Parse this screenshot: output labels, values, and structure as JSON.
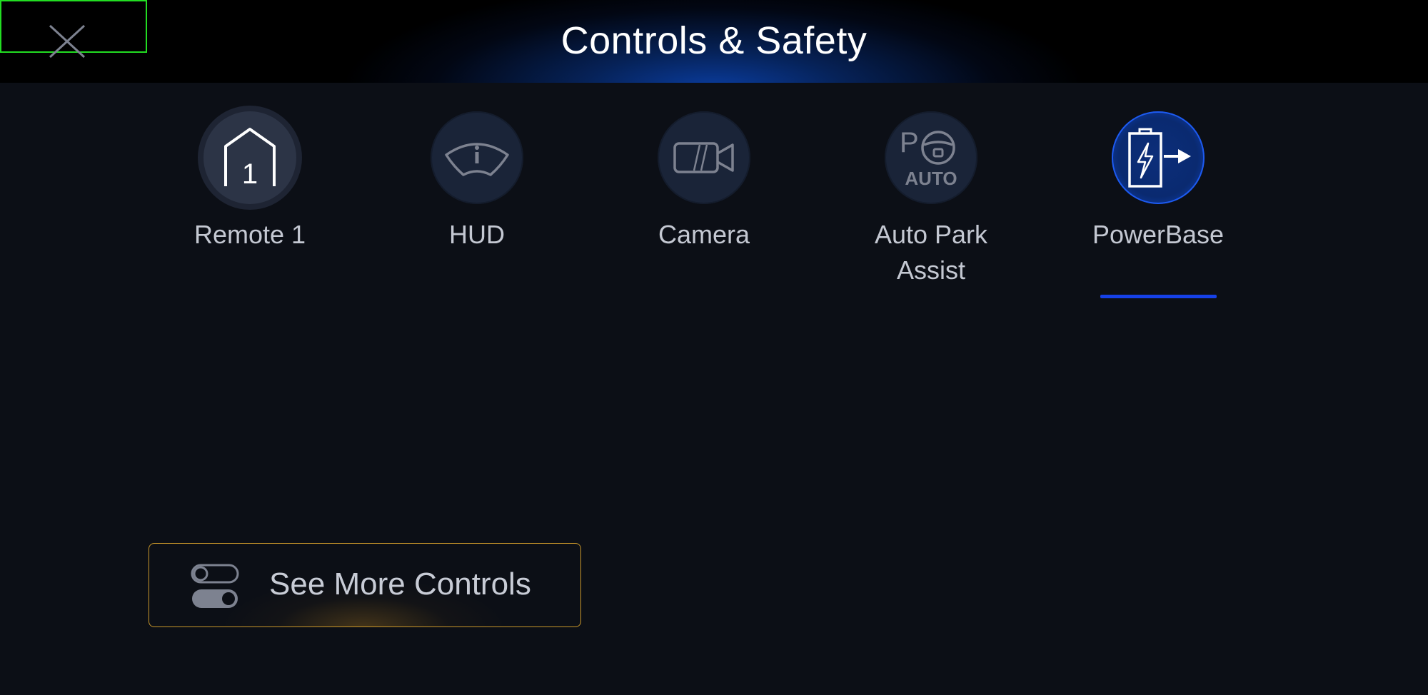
{
  "header": {
    "title": "Controls & Safety",
    "close_icon": "close-icon"
  },
  "tiles": [
    {
      "label": "Remote 1",
      "icon": "garage-remote-icon",
      "badge": "1",
      "active": false
    },
    {
      "label": "HUD",
      "icon": "hud-windshield-icon",
      "active": false
    },
    {
      "label": "Camera",
      "icon": "camera-icon",
      "active": false
    },
    {
      "label": "Auto Park Assist",
      "icon": "auto-park-icon",
      "icon_text_p": "P",
      "icon_text_auto": "AUTO",
      "active": false
    },
    {
      "label": "PowerBase",
      "icon": "powerbase-battery-icon",
      "active": true
    }
  ],
  "more_controls": {
    "label": "See More Controls",
    "icon": "toggle-switches-icon"
  },
  "colors": {
    "accent_blue": "#1641e8",
    "button_border": "#c8962a",
    "background": "#0c0f16"
  }
}
